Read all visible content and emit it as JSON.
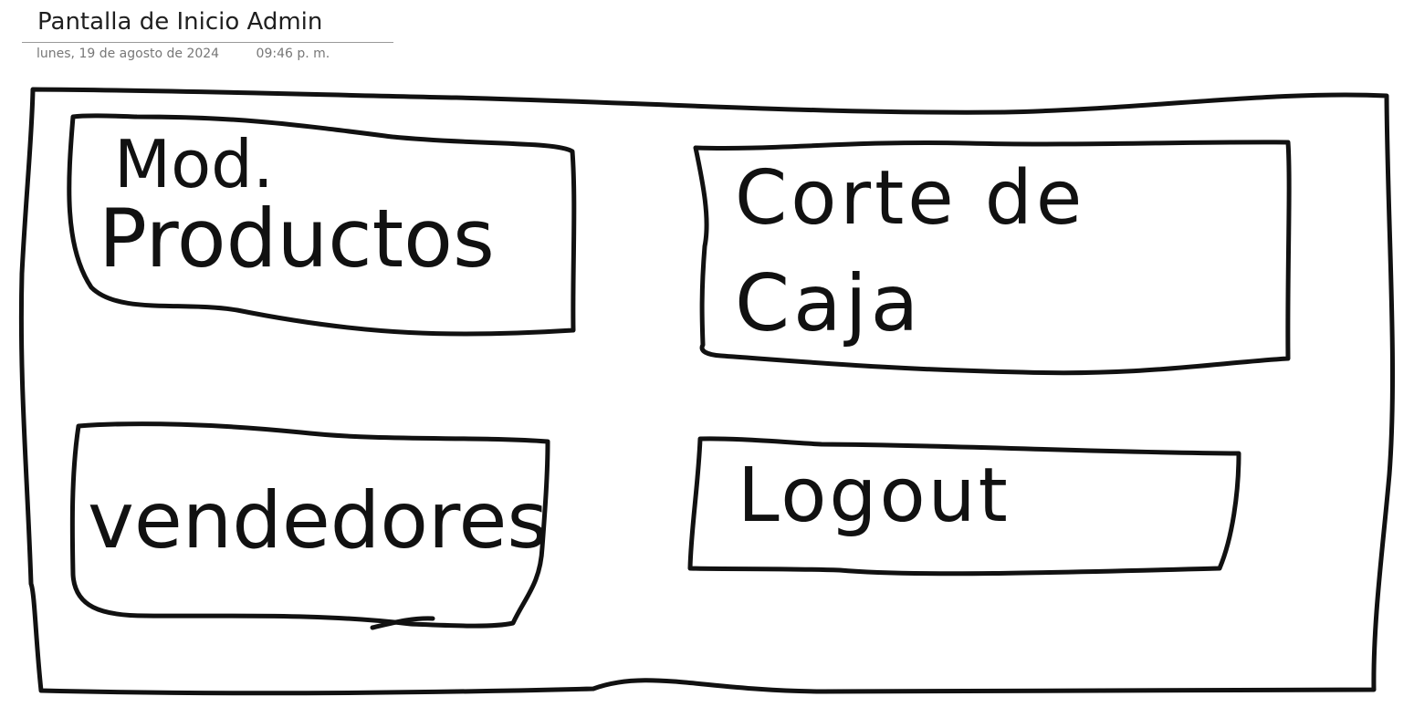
{
  "note": {
    "title": "Pantalla de Inicio Admin",
    "date": "lunes, 19 de agosto de 2024",
    "time": "09:46 p. m."
  },
  "sketch": {
    "buttons": [
      {
        "line1": "Mod.",
        "line2": "Productos"
      },
      {
        "line1": "Corte de",
        "line2": "Caja"
      },
      {
        "line1": "vendedores"
      },
      {
        "line1": "Logout"
      }
    ]
  }
}
